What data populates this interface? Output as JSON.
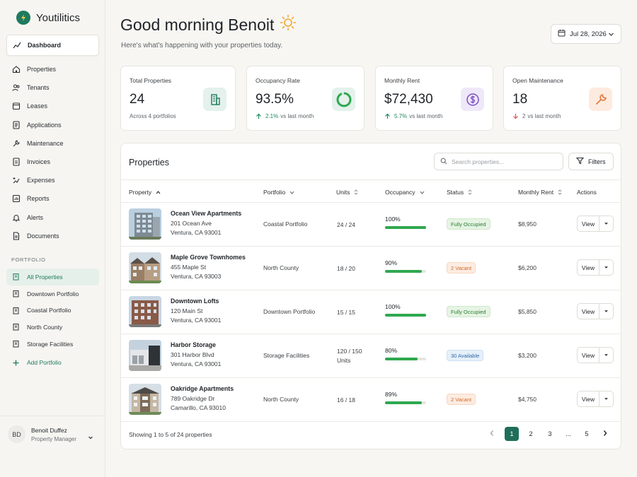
{
  "app": {
    "name": "Youtilitics"
  },
  "sidebar": {
    "nav": [
      {
        "label": "Dashboard",
        "icon": "chart-line-icon"
      },
      {
        "label": "Properties",
        "icon": "home-icon"
      },
      {
        "label": "Tenants",
        "icon": "users-icon"
      },
      {
        "label": "Leases",
        "icon": "lease-icon"
      },
      {
        "label": "Applications",
        "icon": "document-icon"
      },
      {
        "label": "Maintenance",
        "icon": "wrench-icon"
      },
      {
        "label": "Invoices",
        "icon": "invoice-icon"
      },
      {
        "label": "Expenses",
        "icon": "expenses-icon"
      },
      {
        "label": "Reports",
        "icon": "reports-icon"
      },
      {
        "label": "Alerts",
        "icon": "bell-icon"
      },
      {
        "label": "Documents",
        "icon": "documents-icon"
      }
    ],
    "portfolio_label": "PORTFOLIO",
    "portfolios": [
      {
        "label": "All Properties"
      },
      {
        "label": "Downtown Portfolio"
      },
      {
        "label": "Coastal Portfolio"
      },
      {
        "label": "North County"
      },
      {
        "label": "Storage Facilities"
      }
    ],
    "add_portfolio": "Add Portfolio",
    "user": {
      "initials": "BD",
      "name": "Benoit Duffez",
      "role": "Property Manager"
    }
  },
  "header": {
    "greeting": "Good morning Benoit",
    "subtitle": "Here's what's happening with your properties today.",
    "date": "Jul 28, 2026"
  },
  "stats": [
    {
      "label": "Total Properties",
      "value": "24",
      "sub": "Across 4 portfolios"
    },
    {
      "label": "Occupancy Rate",
      "value": "93.5%",
      "delta": "2.1%",
      "sub": "vs last month",
      "ring_fraction": 0.935
    },
    {
      "label": "Monthly Rent",
      "value": "$72,430",
      "delta": "5.7%",
      "sub": "vs last month"
    },
    {
      "label": "Open Maintenance",
      "value": "18",
      "delta": "2",
      "sub": "vs last month"
    }
  ],
  "colors": {
    "accent": "#1f6e5a",
    "up": "#1f8a5e",
    "down": "#d9534f"
  },
  "properties": {
    "title": "Properties",
    "search_placeholder": "Search properties...",
    "filters_label": "Filters",
    "columns": {
      "property": "Property",
      "portfolio": "Portfolio",
      "units": "Units",
      "occupancy": "Occupancy",
      "status": "Status",
      "rent": "Monthly Rent",
      "actions": "Actions"
    },
    "view_label": "View",
    "rows": [
      {
        "name": "Ocean View Apartments",
        "addr1": "201 Ocean Ave",
        "addr2": "Ventura, CA 93001",
        "portfolio": "Coastal Portfolio",
        "units": "24 / 24",
        "occupancy": "100%",
        "occ_fraction": 1.0,
        "status": "Fully Occupied",
        "status_color": "green",
        "rent": "$8,950"
      },
      {
        "name": "Maple Grove Townhomes",
        "addr1": "455 Maple St",
        "addr2": "Ventura, CA 93003",
        "portfolio": "North County",
        "units": "18 / 20",
        "occupancy": "90%",
        "occ_fraction": 0.9,
        "status": "2 Vacant",
        "status_color": "orange",
        "rent": "$6,200"
      },
      {
        "name": "Downtown Lofts",
        "addr1": "120 Main St",
        "addr2": "Ventura, CA 93001",
        "portfolio": "Downtown Portfolio",
        "units": "15 / 15",
        "occupancy": "100%",
        "occ_fraction": 1.0,
        "status": "Fully Occupied",
        "status_color": "green",
        "rent": "$5,850"
      },
      {
        "name": "Harbor Storage",
        "addr1": "301 Harbor Blvd",
        "addr2": "Ventura, CA 93001",
        "portfolio": "Storage Facilities",
        "units": "120 / 150 Units",
        "occupancy": "80%",
        "occ_fraction": 0.8,
        "status": "30 Available",
        "status_color": "blue",
        "rent": "$3,200"
      },
      {
        "name": "Oakridge Apartments",
        "addr1": "789 Oakridge Dr",
        "addr2": "Camarillo, CA 93010",
        "portfolio": "North County",
        "units": "16 / 18",
        "occupancy": "89%",
        "occ_fraction": 0.89,
        "status": "2 Vacant",
        "status_color": "orange",
        "rent": "$4,750"
      }
    ],
    "footer": "Showing 1 to 5 of 24 properties",
    "pages": [
      "1",
      "2",
      "3",
      "...",
      "5"
    ]
  }
}
